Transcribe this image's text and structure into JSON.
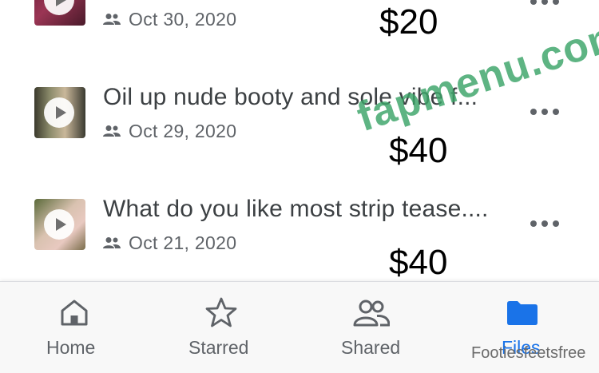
{
  "files": [
    {
      "name": "",
      "date": "Oct 30, 2020",
      "price": "$20"
    },
    {
      "name": "Oil up nude booty and sole vibe f...",
      "date": "Oct 29, 2020",
      "price": "$40"
    },
    {
      "name": "What do you like most strip tease....",
      "date": "Oct 21, 2020",
      "price": "$40"
    }
  ],
  "watermark": "fapmenu.com",
  "nav": {
    "home": "Home",
    "starred": "Starred",
    "shared": "Shared",
    "files": "Files",
    "active": "files"
  },
  "credit": "Footiesfeetsfree",
  "colors": {
    "accent": "#1a73e8",
    "icon_gray": "#5f6368",
    "watermark_green": "#3ba468"
  },
  "icons": {
    "shared_people": "people-icon",
    "more": "more-vert-icon",
    "home": "home-icon",
    "starred": "star-icon",
    "shared": "group-icon",
    "files": "folder-icon",
    "play": "play-icon"
  }
}
